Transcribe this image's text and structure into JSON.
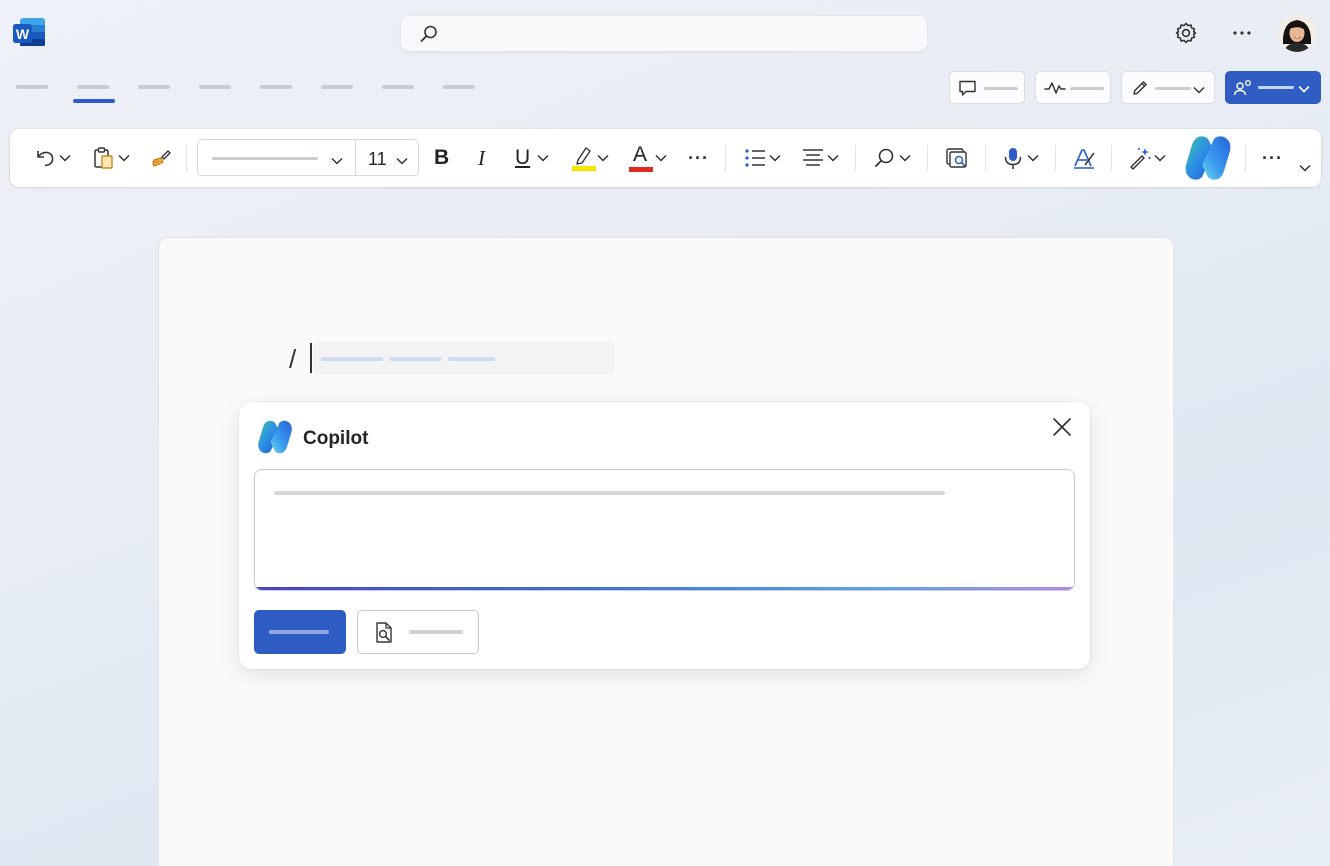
{
  "app": {
    "logo_letter": "W",
    "brand_color": "#2b5cc7"
  },
  "ribbon": {
    "font_size": "11",
    "bold_label": "B",
    "italic_label": "I",
    "underline_label": "U",
    "font_color_label": "A",
    "highlight_color": "#f5e600",
    "font_color": "#e0281f",
    "more_label": "···"
  },
  "document": {
    "slash_command": "/"
  },
  "copilot": {
    "title": "Copilot",
    "accent_gradient": [
      "#4b44c7",
      "#3e6fd8",
      "#56a6e0",
      "#b78ae0"
    ]
  },
  "icons": {
    "titlebar": [
      "word-logo-icon",
      "search-icon",
      "settings-icon",
      "more-icon",
      "avatar"
    ],
    "actions": [
      "comment-icon",
      "activity-icon",
      "pen-icon",
      "share-icon"
    ],
    "ribbon": [
      "undo-icon",
      "paste-icon",
      "format-painter-icon",
      "bullets-icon",
      "align-icon",
      "find-icon",
      "reuse-icon",
      "dictate-icon",
      "editor-icon",
      "designer-icon",
      "copilot-icon"
    ],
    "card": [
      "copilot-logo-icon",
      "close-icon",
      "reference-file-icon"
    ]
  }
}
